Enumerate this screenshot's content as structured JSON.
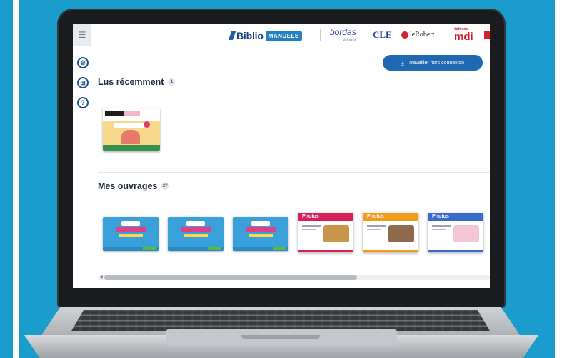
{
  "app": {
    "brand_biblio": "Biblio",
    "brand_manuels": "MANUELS",
    "menu_icon": "hamburger-icon"
  },
  "publishers": {
    "bordas": "bordas",
    "bordas_sub": "éditeur",
    "cle": "CLE",
    "robert": "leRobert",
    "mdi_top": "éditions",
    "mdi": "mdi"
  },
  "toolbar": {
    "offline_label": "Travailler hors connexion",
    "offline_icon": "download-icon"
  },
  "sidebar": {
    "icons": [
      "gear-icon",
      "grid-icon",
      "help-icon"
    ]
  },
  "sections": {
    "recent_title": "Lus récemment",
    "recent_count": "1",
    "works_title": "Mes ouvrages",
    "works_count": "27"
  },
  "books": [
    {
      "title": "Vocabulaire"
    },
    {
      "title": "Vocabulaire"
    },
    {
      "title": "Vocabulaire"
    },
    {
      "title": "Photos",
      "accent": "#d6225a"
    },
    {
      "title": "Photos",
      "accent": "#f29a1d"
    },
    {
      "title": "Photos",
      "accent": "#3a6bc8"
    }
  ],
  "colors": {
    "background": "#1a9ccc",
    "brand_blue": "#16487f",
    "button_blue": "#1f69b3"
  }
}
